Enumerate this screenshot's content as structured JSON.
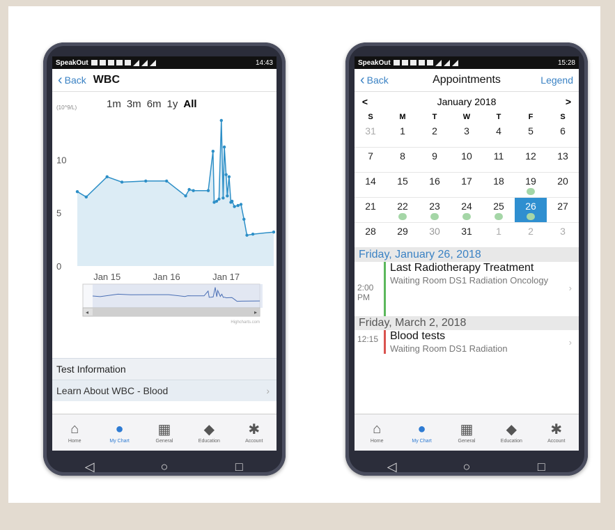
{
  "colors": {
    "accent": "#3a82c4",
    "chart_line": "#2d8fc7",
    "chart_fill": "#dcecf5",
    "selected_day": "#2f8fd0",
    "appt_dot": "#a5d6a7",
    "bar_green": "#5cb85c",
    "bar_red": "#d9534f"
  },
  "left": {
    "status": {
      "app": "SpeakOut",
      "time": "14:43"
    },
    "nav": {
      "back": "Back",
      "title": "WBC"
    },
    "ranges": {
      "unit": "(10^9/L)",
      "items": [
        "1m",
        "3m",
        "6m",
        "1y",
        "All"
      ],
      "selected": "All"
    },
    "info": {
      "section": "Test Information",
      "link": "Learn About WBC - Blood"
    },
    "navigator_credit": "Highcharts.com"
  },
  "chart_data": {
    "type": "line",
    "title": "",
    "xlabel": "",
    "ylabel": "(10^9/L)",
    "ylim": [
      0,
      13.5
    ],
    "yticks": [
      0,
      5,
      10
    ],
    "xticks": [
      "Jan 15",
      "Jan 16",
      "Jan 17"
    ],
    "grid": false,
    "series": [
      {
        "x": [
          0.0,
          0.15,
          0.5,
          0.75,
          1.15,
          1.5,
          1.82,
          1.88,
          1.95,
          2.2,
          2.28,
          2.3,
          2.34,
          2.38,
          2.42,
          2.45,
          2.47,
          2.5,
          2.52,
          2.55,
          2.58,
          2.6,
          2.64,
          2.7,
          2.75,
          2.8,
          2.85,
          2.95,
          3.3
        ],
        "values": [
          7.0,
          6.5,
          8.4,
          7.9,
          8.0,
          8.0,
          6.6,
          7.2,
          7.1,
          7.1,
          10.8,
          6.0,
          6.1,
          6.3,
          13.7,
          6.4,
          11.2,
          8.6,
          6.6,
          8.4,
          6.0,
          6.1,
          5.6,
          5.7,
          5.8,
          4.4,
          2.9,
          3.0,
          3.2
        ]
      }
    ]
  },
  "right": {
    "status": {
      "app": "SpeakOut",
      "time": "15:28"
    },
    "nav": {
      "back": "Back",
      "title": "Appointments",
      "legend": "Legend"
    },
    "calendar": {
      "month": "January 2018",
      "prev": "<",
      "next": ">",
      "dow": [
        "S",
        "M",
        "T",
        "W",
        "T",
        "F",
        "S"
      ],
      "days": [
        "31",
        "1",
        "2",
        "3",
        "4",
        "5",
        "6",
        "7",
        "8",
        "9",
        "10",
        "11",
        "12",
        "13",
        "14",
        "15",
        "16",
        "17",
        "18",
        "19",
        "20",
        "21",
        "22",
        "23",
        "24",
        "25",
        "26",
        "27",
        "28",
        "29",
        "30",
        "31",
        "1",
        "2",
        "3"
      ],
      "muted": [
        0,
        32,
        33,
        34
      ],
      "light": [
        30
      ],
      "dots": [
        19,
        22,
        23,
        24,
        25,
        26
      ],
      "selected": 26
    },
    "appointments": [
      {
        "date": "Friday, January 26, 2018",
        "time": "2:00 PM",
        "title": "Last Radiotherapy Treatment",
        "location": "Waiting Room DS1 Radiation Oncology"
      },
      {
        "date": "Friday, March 2, 2018",
        "time": "12:15",
        "title": "Blood tests",
        "location": "Waiting Room DS1 Radiation"
      }
    ]
  },
  "tabs": [
    {
      "label": "Home",
      "icon": "home-icon"
    },
    {
      "label": "My Chart",
      "icon": "person-icon"
    },
    {
      "label": "General",
      "icon": "grid-icon"
    },
    {
      "label": "Education",
      "icon": "graduation-cap-icon"
    },
    {
      "label": "Account",
      "icon": "gear-icon"
    }
  ],
  "active_tab": "My Chart",
  "android_nav": {
    "back": "◁",
    "home": "○",
    "recents": "□"
  }
}
